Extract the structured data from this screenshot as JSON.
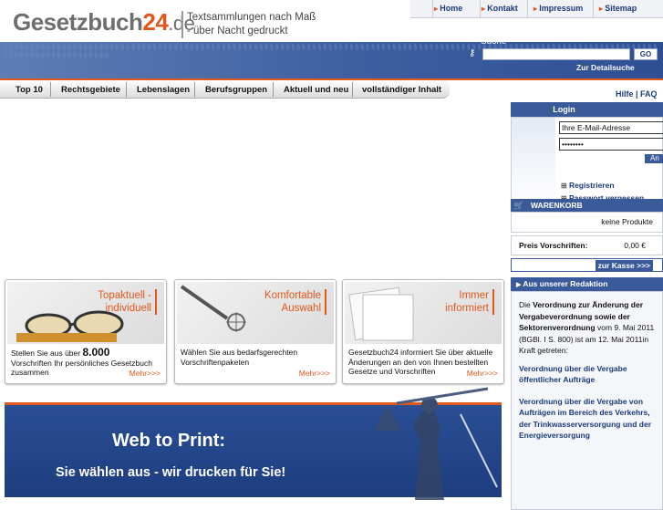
{
  "header": {
    "logo_main": "Gesetzbuch",
    "logo_num": "24",
    "logo_dom": ".de",
    "slogan_1": "Textsammlungen nach Maß",
    "slogan_2": "- über Nacht gedruckt"
  },
  "topnav": [
    "Home",
    "Kontakt",
    "Impressum",
    "Sitemap"
  ],
  "search": {
    "label": "Suche",
    "go": "GO",
    "detail": "Zur Detailsuche"
  },
  "mainnav": [
    "Top 10",
    "Rechtsgebiete",
    "Lebenslagen",
    "Berufsgruppen",
    "Aktuell und neu",
    "vollständiger Inhalt"
  ],
  "help": "Hilfe | FAQ",
  "login": {
    "title": "Login",
    "email": "Ihre E-Mail-Adresse",
    "password": "••••••••",
    "submit": "An",
    "register": "Registrieren",
    "forgot": "Passwort vergessen"
  },
  "cart": {
    "title": "WARENKORB",
    "empty": "keine Produkte",
    "price_label": "Preis Vorschriften:",
    "price_value": "0,00 €",
    "checkout": "zur Kasse >>>"
  },
  "redaktion": {
    "title": "Aus unserer Redaktion",
    "intro_pre": "Die ",
    "intro_bold": "Verordnung zur Änderung der Vergabeverordnung sowie der Sektorenverordnung",
    "intro_post": " vom 9. Mai 2011 (BGBl. I S. 800) ist am 12. Mai 2011in Kraft getreten:",
    "link1": "Verordnung über die Vergabe öffentlicher Aufträge",
    "link2": "Verordnung über die Vergabe von Aufträgen im Bereich des Verkehrs, der Trinkwasserversorgung und der Energieversorgung"
  },
  "panels": [
    {
      "title_1": "Topaktuell -",
      "title_2": "individuell",
      "text_pre": "Stellen Sie aus über ",
      "text_big": "8.000",
      "text_post": " Vorschriften Ihr persönliches Gesetzbuch zusammen",
      "more": "Mehr>>>"
    },
    {
      "title_1": "Komfortable",
      "title_2": "Auswahl",
      "text_pre": "Wählen Sie aus bedarfsgerechten Vorschriftenpaketen",
      "text_big": "",
      "text_post": "",
      "more": "Mehr>>>"
    },
    {
      "title_1": "Immer",
      "title_2": "informiert",
      "text_pre": "Gesetzbuch24 informiert Sie über aktuelle Änderungen an den von Ihnen bestellten Gesetze und Vorschriften",
      "text_big": "",
      "text_post": "",
      "more": "Mehr>>>"
    }
  ],
  "hero": {
    "title": "Web to Print:",
    "subtitle": "Sie wählen aus - wir drucken für Sie!"
  }
}
